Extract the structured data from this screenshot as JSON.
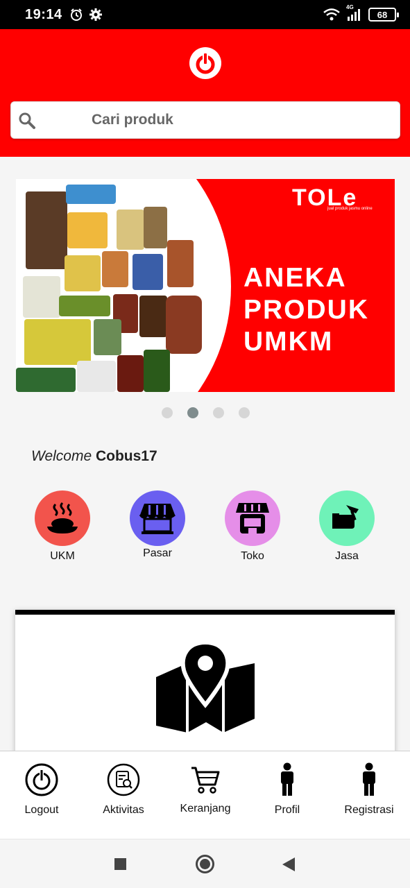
{
  "status_bar": {
    "time": "19:14",
    "network": "4G",
    "battery": "68"
  },
  "search": {
    "placeholder": "Cari produk"
  },
  "banner": {
    "brand": "TOLe",
    "brand_tagline": "jual produk jasmu online",
    "headline": [
      "ANEKA",
      "PRODUK",
      "UMKM"
    ],
    "slide_count": 4,
    "active_slide": 2
  },
  "welcome": {
    "prefix": "Welcome",
    "username": "Cobus17"
  },
  "categories": [
    {
      "label": "UKM",
      "icon": "food-bowl-icon",
      "color": "#f2544c"
    },
    {
      "label": "Pasar",
      "icon": "market-stall-icon",
      "color": "#6a5ff0"
    },
    {
      "label": "Toko",
      "icon": "shop-icon",
      "color": "#e58ee8"
    },
    {
      "label": "Jasa",
      "icon": "service-hand-icon",
      "color": "#6ff2b8"
    }
  ],
  "card": {
    "icon": "map-marker-icon"
  },
  "bottom_nav": [
    {
      "label": "Logout",
      "icon": "power-icon"
    },
    {
      "label": "Aktivitas",
      "icon": "activity-icon"
    },
    {
      "label": "Keranjang",
      "icon": "cart-icon"
    },
    {
      "label": "Profil",
      "icon": "person-icon"
    },
    {
      "label": "Registrasi",
      "icon": "person-icon"
    }
  ],
  "colors": {
    "brand_red": "#ff0000",
    "dot_active": "#7f8c8d",
    "dot_inactive": "#d6d6d6"
  }
}
